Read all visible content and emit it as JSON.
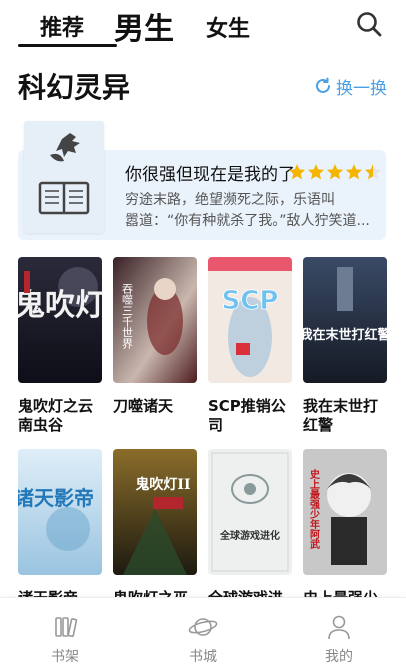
{
  "top_tabs": {
    "recommended": "推荐",
    "boys": "男生",
    "girls": "女生"
  },
  "section": {
    "title": "科幻灵异",
    "refresh_label": "换一换"
  },
  "featured": {
    "title": "你很强但现在是我的了",
    "rating": 4.5,
    "desc_line1": "穷途末路，绝望濒死之际，乐语叫",
    "desc_line2": "嚣道：“你有种就杀了我。”敌人狞笑道..."
  },
  "books": [
    {
      "name": "鬼吹灯之云南虫谷",
      "cover_text": "鬼吹灯"
    },
    {
      "name": "刀噬诸天",
      "cover_text": "吞噬三千世界"
    },
    {
      "name": "SCP推销公司",
      "cover_text": "SCP"
    },
    {
      "name": "我在末世打红警",
      "cover_text": "我在末世打红警"
    },
    {
      "name": "诸天影帝",
      "cover_text": "诸天影帝"
    },
    {
      "name": "鬼吹灯之巫峡棺山",
      "cover_text": "鬼吹灯II"
    },
    {
      "name": "全球游戏进化",
      "cover_text": "全球游戏进化"
    },
    {
      "name": "史上最强少年",
      "cover_text": "史上最强少年阿武"
    }
  ],
  "bottom_nav": {
    "shelf": "书架",
    "store": "书城",
    "mine": "我的"
  },
  "colors": {
    "accent": "#4aa0e6",
    "star": "#f4b400",
    "feature_bg": "#eaf2fb"
  }
}
